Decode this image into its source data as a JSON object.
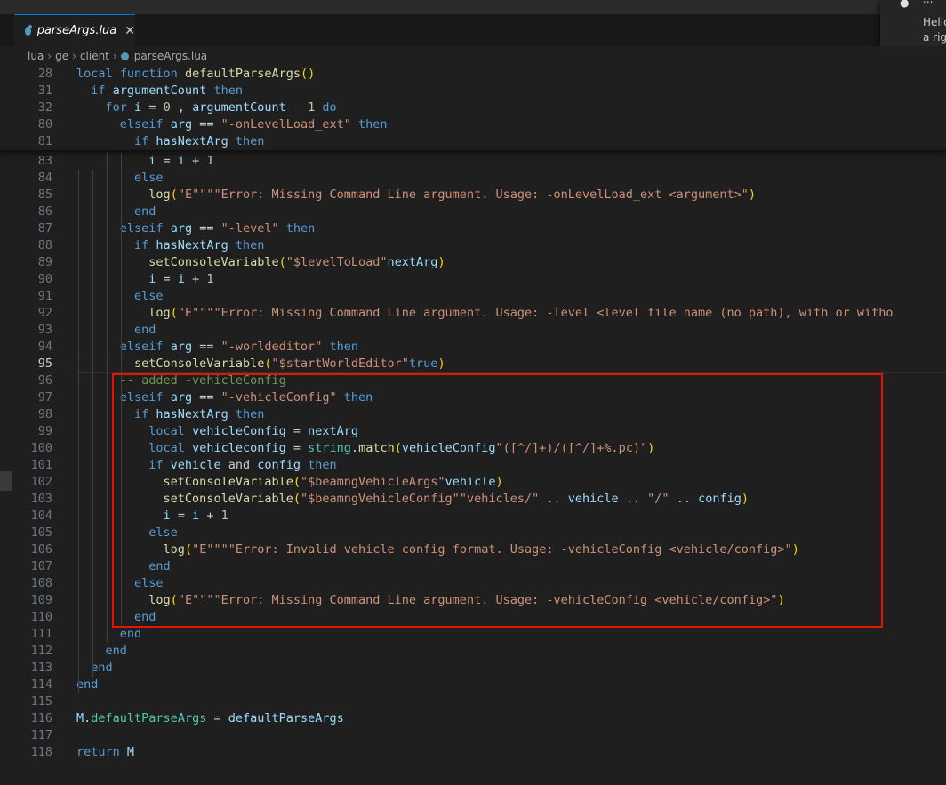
{
  "tab": {
    "label": "parseArgs.lua",
    "close_glyph": "✕"
  },
  "notification": {
    "head": "...",
    "line1": "Hello",
    "line2": "a righ"
  },
  "breadcrumb": [
    "lua",
    "ge",
    "client",
    "parseArgs.lua"
  ],
  "editor": {
    "current_line": "95",
    "lines": [
      {
        "n": "28",
        "t": [
          [
            "kw",
            "local "
          ],
          [
            "kw",
            "function "
          ],
          [
            "fn",
            "defaultParseArgs"
          ],
          [
            "br1",
            "()"
          ]
        ]
      },
      {
        "n": "31",
        "t": [
          [
            "",
            "  "
          ],
          [
            "kw",
            "if "
          ],
          [
            "var",
            "argumentCount "
          ],
          [
            "kw",
            "then"
          ]
        ]
      },
      {
        "n": "32",
        "t": [
          [
            "",
            "    "
          ],
          [
            "kw",
            "for "
          ],
          [
            "var",
            "i "
          ],
          [
            "",
            "= "
          ],
          [
            "num",
            "0"
          ],
          [
            "",
            " , "
          ],
          [
            "var",
            "argumentCount "
          ],
          [
            "",
            "- "
          ],
          [
            "num",
            "1 "
          ],
          [
            "kw",
            "do"
          ]
        ]
      },
      {
        "n": "80",
        "t": [
          [
            "",
            "      "
          ],
          [
            "kw",
            "elseif "
          ],
          [
            "var",
            "arg "
          ],
          [
            "",
            "== "
          ],
          [
            "str",
            "\"-onLevelLoad_ext\" "
          ],
          [
            "kw",
            "then"
          ]
        ]
      },
      {
        "n": "81",
        "t": [
          [
            "",
            "        "
          ],
          [
            "kw",
            "if "
          ],
          [
            "var",
            "hasNextArg "
          ],
          [
            "kw",
            "then"
          ]
        ]
      },
      {
        "n": "83",
        "t": [
          [
            "",
            "          "
          ],
          [
            "var",
            "i "
          ],
          [
            "",
            "= "
          ],
          [
            "var",
            "i "
          ],
          [
            "",
            "+ "
          ],
          [
            "num",
            "1"
          ]
        ]
      },
      {
        "n": "84",
        "t": [
          [
            "",
            "        "
          ],
          [
            "kw",
            "else"
          ]
        ]
      },
      {
        "n": "85",
        "t": [
          [
            "",
            "          "
          ],
          [
            "fn",
            "log"
          ],
          [
            "br1",
            "("
          ],
          [
            "str",
            "\"E\""
          ],
          [
            ", "
          ],
          [
            "str",
            "\"\""
          ],
          [
            ", "
          ],
          [
            "str",
            "\"Error: Missing Command Line argument. Usage: -onLevelLoad_ext <argument>\""
          ],
          [
            "br1",
            ")"
          ]
        ]
      },
      {
        "n": "86",
        "t": [
          [
            "",
            "        "
          ],
          [
            "kw",
            "end"
          ]
        ]
      },
      {
        "n": "87",
        "t": [
          [
            "",
            "      "
          ],
          [
            "kw",
            "elseif "
          ],
          [
            "var",
            "arg "
          ],
          [
            "",
            "== "
          ],
          [
            "str",
            "\"-level\" "
          ],
          [
            "kw",
            "then"
          ]
        ]
      },
      {
        "n": "88",
        "t": [
          [
            "",
            "        "
          ],
          [
            "kw",
            "if "
          ],
          [
            "var",
            "hasNextArg "
          ],
          [
            "kw",
            "then"
          ]
        ]
      },
      {
        "n": "89",
        "t": [
          [
            "",
            "          "
          ],
          [
            "fn",
            "setConsoleVariable"
          ],
          [
            "br1",
            "("
          ],
          [
            "str",
            "\"$levelToLoad\""
          ],
          [
            ", "
          ],
          [
            "var",
            "nextArg"
          ],
          [
            "br1",
            ")"
          ]
        ]
      },
      {
        "n": "90",
        "t": [
          [
            "",
            "          "
          ],
          [
            "var",
            "i "
          ],
          [
            "",
            "= "
          ],
          [
            "var",
            "i "
          ],
          [
            "",
            "+ "
          ],
          [
            "num",
            "1"
          ]
        ]
      },
      {
        "n": "91",
        "t": [
          [
            "",
            "        "
          ],
          [
            "kw",
            "else"
          ]
        ]
      },
      {
        "n": "92",
        "t": [
          [
            "",
            "          "
          ],
          [
            "fn",
            "log"
          ],
          [
            "br1",
            "("
          ],
          [
            "str",
            "\"E\""
          ],
          [
            ", "
          ],
          [
            "str",
            "\"\""
          ],
          [
            ", "
          ],
          [
            "str",
            "\"Error: Missing Command Line argument. Usage: -level <level file name (no path), with or witho"
          ]
        ]
      },
      {
        "n": "93",
        "t": [
          [
            "",
            "        "
          ],
          [
            "kw",
            "end"
          ]
        ]
      },
      {
        "n": "94",
        "t": [
          [
            "",
            "      "
          ],
          [
            "kw",
            "elseif "
          ],
          [
            "var",
            "arg "
          ],
          [
            "",
            "== "
          ],
          [
            "str",
            "\"-worldeditor\" "
          ],
          [
            "kw",
            "then"
          ]
        ]
      },
      {
        "n": "95",
        "t": [
          [
            "",
            "        "
          ],
          [
            "fn",
            "setConsoleVariable"
          ],
          [
            "br1",
            "("
          ],
          [
            "str",
            "\"$startWorldEditor\""
          ],
          [
            ", "
          ],
          [
            "kw",
            "true"
          ],
          [
            "br1",
            ")"
          ]
        ]
      },
      {
        "n": "96",
        "t": [
          [
            "",
            "      "
          ],
          [
            "com",
            "-- added -vehicleConfig"
          ]
        ]
      },
      {
        "n": "97",
        "t": [
          [
            "",
            "      "
          ],
          [
            "kw",
            "elseif "
          ],
          [
            "var",
            "arg "
          ],
          [
            "",
            "== "
          ],
          [
            "str",
            "\"-vehicleConfig\" "
          ],
          [
            "kw",
            "then"
          ]
        ]
      },
      {
        "n": "98",
        "t": [
          [
            "",
            "        "
          ],
          [
            "kw",
            "if "
          ],
          [
            "var",
            "hasNextArg "
          ],
          [
            "kw",
            "then"
          ]
        ]
      },
      {
        "n": "99",
        "t": [
          [
            "",
            "          "
          ],
          [
            "kw",
            "local "
          ],
          [
            "var",
            "vehicleConfig "
          ],
          [
            "",
            "= "
          ],
          [
            "var",
            "nextArg"
          ]
        ]
      },
      {
        "n": "100",
        "t": [
          [
            "",
            "          "
          ],
          [
            "kw",
            "local "
          ],
          [
            "var",
            "vehicle"
          ],
          [
            ", "
          ],
          [
            "var",
            "config "
          ],
          [
            "",
            "= "
          ],
          [
            "mem",
            "string"
          ],
          [
            "",
            "."
          ],
          [
            "fn",
            "match"
          ],
          [
            "br1",
            "("
          ],
          [
            "var",
            "vehicleConfig"
          ],
          [
            ", "
          ],
          [
            "str",
            "\"([^/]+)/([^/]+%.pc)\""
          ],
          [
            "br1",
            ")"
          ]
        ]
      },
      {
        "n": "101",
        "t": [
          [
            "",
            "          "
          ],
          [
            "kw",
            "if "
          ],
          [
            "var",
            "vehicle "
          ],
          [
            "",
            "and "
          ],
          [
            "var",
            "config "
          ],
          [
            "kw",
            "then"
          ]
        ]
      },
      {
        "n": "102",
        "t": [
          [
            "",
            "            "
          ],
          [
            "fn",
            "setConsoleVariable"
          ],
          [
            "br1",
            "("
          ],
          [
            "str",
            "\"$beamngVehicleArgs\""
          ],
          [
            ", "
          ],
          [
            "var",
            "vehicle"
          ],
          [
            "br1",
            ")"
          ]
        ]
      },
      {
        "n": "103",
        "t": [
          [
            "",
            "            "
          ],
          [
            "fn",
            "setConsoleVariable"
          ],
          [
            "br1",
            "("
          ],
          [
            "str",
            "\"$beamngVehicleConfig\""
          ],
          [
            ", "
          ],
          [
            "str",
            "\"vehicles/\" "
          ],
          [
            "",
            ".. "
          ],
          [
            "var",
            "vehicle "
          ],
          [
            "",
            ".. "
          ],
          [
            "str",
            "\"/\" "
          ],
          [
            "",
            ".. "
          ],
          [
            "var",
            "config"
          ],
          [
            "br1",
            ")"
          ]
        ]
      },
      {
        "n": "104",
        "t": [
          [
            "",
            "            "
          ],
          [
            "var",
            "i "
          ],
          [
            "",
            "= "
          ],
          [
            "var",
            "i "
          ],
          [
            "",
            "+ "
          ],
          [
            "num",
            "1"
          ]
        ]
      },
      {
        "n": "105",
        "t": [
          [
            "",
            "          "
          ],
          [
            "kw",
            "else"
          ]
        ]
      },
      {
        "n": "106",
        "t": [
          [
            "",
            "            "
          ],
          [
            "fn",
            "log"
          ],
          [
            "br1",
            "("
          ],
          [
            "str",
            "\"E\""
          ],
          [
            ", "
          ],
          [
            "str",
            "\"\""
          ],
          [
            ", "
          ],
          [
            "str",
            "\"Error: Invalid vehicle config format. Usage: -vehicleConfig <vehicle/config>\""
          ],
          [
            "br1",
            ")"
          ]
        ]
      },
      {
        "n": "107",
        "t": [
          [
            "",
            "          "
          ],
          [
            "kw",
            "end"
          ]
        ]
      },
      {
        "n": "108",
        "t": [
          [
            "",
            "        "
          ],
          [
            "kw",
            "else"
          ]
        ]
      },
      {
        "n": "109",
        "t": [
          [
            "",
            "          "
          ],
          [
            "fn",
            "log"
          ],
          [
            "br1",
            "("
          ],
          [
            "str",
            "\"E\""
          ],
          [
            ", "
          ],
          [
            "str",
            "\"\""
          ],
          [
            ", "
          ],
          [
            "str",
            "\"Error: Missing Command Line argument. Usage: -vehicleConfig <vehicle/config>\""
          ],
          [
            "br1",
            ")"
          ]
        ]
      },
      {
        "n": "110",
        "t": [
          [
            "",
            "        "
          ],
          [
            "kw",
            "end"
          ]
        ]
      },
      {
        "n": "111",
        "t": [
          [
            "",
            "      "
          ],
          [
            "kw",
            "end"
          ]
        ]
      },
      {
        "n": "112",
        "t": [
          [
            "",
            "    "
          ],
          [
            "kw",
            "end"
          ]
        ]
      },
      {
        "n": "113",
        "t": [
          [
            "",
            "  "
          ],
          [
            "kw",
            "end"
          ]
        ]
      },
      {
        "n": "114",
        "t": [
          [
            "kw",
            "end"
          ]
        ]
      },
      {
        "n": "115",
        "t": []
      },
      {
        "n": "116",
        "t": [
          [
            "var",
            "M"
          ],
          [
            "",
            "."
          ],
          [
            "mem",
            "defaultParseArgs "
          ],
          [
            "",
            "= "
          ],
          [
            "var",
            "defaultParseArgs"
          ]
        ]
      },
      {
        "n": "117",
        "t": []
      },
      {
        "n": "118",
        "t": [
          [
            "kw",
            "return "
          ],
          [
            "var",
            "M"
          ]
        ]
      }
    ]
  }
}
